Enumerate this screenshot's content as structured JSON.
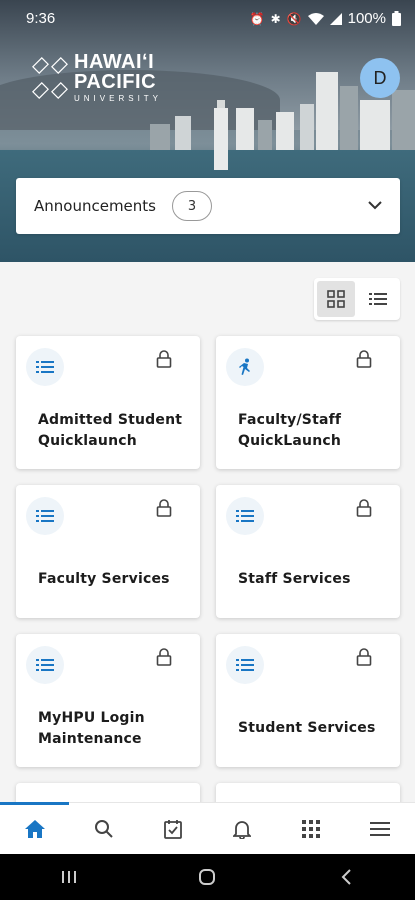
{
  "status_bar": {
    "time": "9:36",
    "battery": "100%"
  },
  "header": {
    "logo_line1": "HAWAIʻI",
    "logo_line2": "PACIFIC",
    "logo_line3": "UNIVERSITY",
    "avatar_initial": "D"
  },
  "announcements": {
    "label": "Announcements",
    "count": "3"
  },
  "cards": [
    {
      "label_line1": "Admitted Student",
      "label_line2": "Quicklaunch",
      "icon": "list-icon"
    },
    {
      "label_line1": "Faculty/Staff",
      "label_line2": "QuickLaunch",
      "icon": "runner-icon"
    },
    {
      "label_line1": "Faculty Services",
      "label_line2": "",
      "icon": "list-icon"
    },
    {
      "label_line1": "Staff Services",
      "label_line2": "",
      "icon": "list-icon"
    },
    {
      "label_line1": "MyHPU Login",
      "label_line2": "Maintenance",
      "icon": "list-icon"
    },
    {
      "label_line1": "Student Services",
      "label_line2": "",
      "icon": "list-icon"
    }
  ],
  "bottom_nav": [
    "home",
    "search",
    "tasks",
    "notifications",
    "apps",
    "menu"
  ],
  "colors": {
    "accent": "#1976c4",
    "avatar": "#8ec2f0"
  }
}
